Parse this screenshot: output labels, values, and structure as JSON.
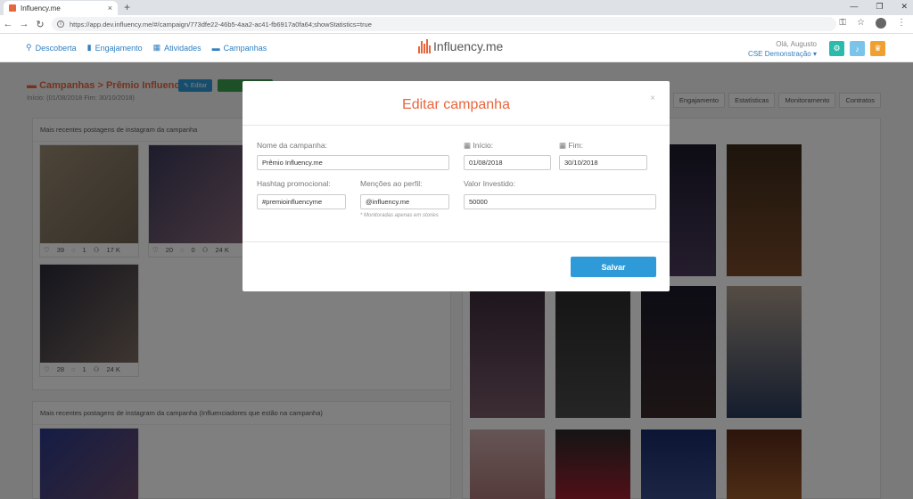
{
  "browser": {
    "tab_title": "Influency.me",
    "tab_close": "×",
    "new_tab": "+",
    "url": "https://app.dev.influency.me/#/campaign/773dfe22-46b5-4aa2-ac41-fb6917a0fa64;showStatistics=true"
  },
  "header": {
    "nav": [
      {
        "label": "Descoberta",
        "icon": "search-icon"
      },
      {
        "label": "Engajamento",
        "icon": "bar-chart-icon"
      },
      {
        "label": "Atividades",
        "icon": "calendar-icon"
      },
      {
        "label": "Campanhas",
        "icon": "folder-icon"
      }
    ],
    "logo_text": "Influency.me",
    "greeting": "Olá, Augusto",
    "account": "CSE Demonstração",
    "accent": "#e8663d",
    "link_color": "#2f7fc1"
  },
  "page": {
    "breadcrumb": "Campanhas > Prêmio Influency.me",
    "dates": "Início: (01/08/2018 Fim: 30/10/2018)",
    "edit_btn": "Editar",
    "tabs": [
      "Engajamento",
      "Estatísticas",
      "Monitoramento",
      "Contratos"
    ],
    "panel1_title": "Mais recentes postagens de instagram da campanha",
    "panel2_title": "Mais recentes postagens de instagram da campanha (Influenciadores que estão na campanha)",
    "cards": [
      {
        "likes": "39",
        "comments": "1",
        "followers": "17 K"
      },
      {
        "likes": "20",
        "comments": "0",
        "followers": "24 K"
      },
      {
        "likes": "28",
        "comments": "1",
        "followers": "24 K"
      }
    ]
  },
  "modal": {
    "title": "Editar campanha",
    "close": "×",
    "name_label": "Nome da campanha:",
    "name_value": "Prêmio Influency.me",
    "start_label": "Início:",
    "start_value": "01/08/2018",
    "end_label": "Fim:",
    "end_value": "30/10/2018",
    "hashtag_label": "Hashtag promocional:",
    "hashtag_value": "#premioinfluencyme",
    "mentions_label": "Menções ao perfil:",
    "mentions_value": "@influency.me",
    "mentions_hint": "* Monitoradas apenas em stories",
    "invest_label": "Valor Investido:",
    "invest_value": "50000",
    "save_label": "Salvar"
  }
}
